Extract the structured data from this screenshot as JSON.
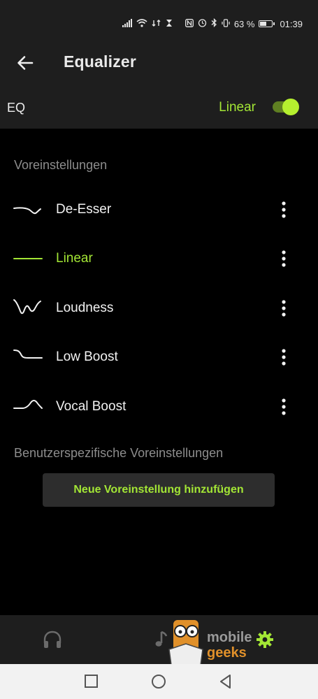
{
  "statusbar": {
    "battery_percent": "63 %",
    "battery_level": 0.63,
    "time": "01:39",
    "icons": [
      "signal-icon",
      "wifi-icon",
      "data-transfer-icon",
      "hourglass-icon",
      "nfc-icon",
      "alarm-icon",
      "bluetooth-icon",
      "vibrate-icon",
      "battery-icon"
    ]
  },
  "appbar": {
    "back_icon": "arrow-left-icon",
    "title": "Equalizer"
  },
  "eq": {
    "label": "EQ",
    "current_preset": "Linear",
    "enabled": true
  },
  "presets_section": {
    "label": "Voreinstellungen",
    "items": [
      {
        "name": "De-Esser",
        "curve": "de-esser-curve-icon",
        "active": false
      },
      {
        "name": "Linear",
        "curve": "linear-curve-icon",
        "active": true
      },
      {
        "name": "Loudness",
        "curve": "loudness-curve-icon",
        "active": false
      },
      {
        "name": "Low Boost",
        "curve": "low-boost-curve-icon",
        "active": false
      },
      {
        "name": "Vocal Boost",
        "curve": "vocal-boost-curve-icon",
        "active": false
      }
    ]
  },
  "custom_section": {
    "label": "Benutzerspezifische Voreinstellungen",
    "add_button": "Neue Voreinstellung hinzufügen"
  },
  "bottom_tabs": [
    {
      "icon": "headphones-icon",
      "active": false
    },
    {
      "icon": "music-note-icon",
      "active": false
    },
    {
      "icon": "gear-icon",
      "active": true
    }
  ],
  "watermark": {
    "text_1": "mobile",
    "text_2": "geeks"
  },
  "navbar": [
    "square-recents-icon",
    "circle-home-icon",
    "triangle-back-icon"
  ],
  "colors": {
    "accent": "#a3e635",
    "surface": "#1e1e1e",
    "background": "#000000",
    "muted_text": "#8d8d8d"
  }
}
